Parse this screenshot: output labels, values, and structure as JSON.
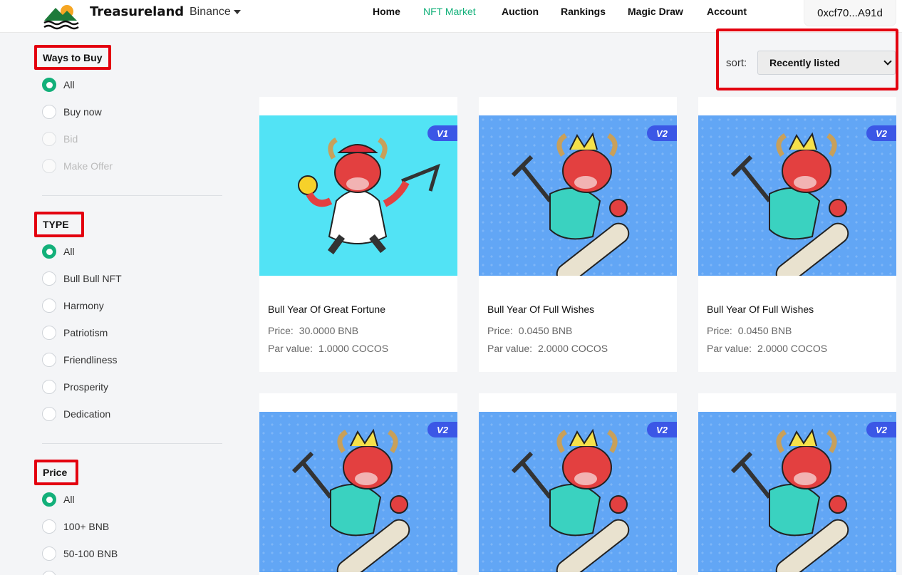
{
  "header": {
    "brand": "Treasureland",
    "network": "Binance",
    "nav": [
      "Home",
      "NFT Market",
      "Auction",
      "Rankings",
      "Magic Draw",
      "Account"
    ],
    "active_nav": "NFT Market",
    "wallet": "0xcf70...A91d"
  },
  "filters": {
    "ways_to_buy": {
      "title": "Ways to Buy",
      "options": [
        "All",
        "Buy now",
        "Bid",
        "Make Offer"
      ],
      "selected": "All",
      "disabled": [
        "Bid",
        "Make Offer"
      ]
    },
    "type": {
      "title": "TYPE",
      "options": [
        "All",
        "Bull Bull NFT",
        "Harmony",
        "Patriotism",
        "Friendliness",
        "Prosperity",
        "Dedication"
      ],
      "selected": "All"
    },
    "price": {
      "title": "Price",
      "options": [
        "All",
        "100+ BNB",
        "50-100 BNB"
      ],
      "selected": "All"
    }
  },
  "sort": {
    "label": "sort:",
    "value": "Recently listed"
  },
  "cards": [
    {
      "version": "V1",
      "title": "Bull Year Of Great Fortune",
      "price_label": "Price:",
      "price": "30.0000 BNB",
      "par_label": "Par value:",
      "par": "1.0000 COCOS"
    },
    {
      "version": "V2",
      "title": "Bull Year Of Full Wishes",
      "price_label": "Price:",
      "price": "0.0450 BNB",
      "par_label": "Par value:",
      "par": "2.0000 COCOS"
    },
    {
      "version": "V2",
      "title": "Bull Year Of Full Wishes",
      "price_label": "Price:",
      "price": "0.0450 BNB",
      "par_label": "Par value:",
      "par": "2.0000 COCOS"
    },
    {
      "version": "V2"
    },
    {
      "version": "V2"
    },
    {
      "version": "V2"
    }
  ],
  "colors": {
    "accent": "#13b07a",
    "highlight": "#e3000f",
    "v1_bg": "#52e3f5",
    "v2_bg": "#62a6f5",
    "badge": "#3b57e6"
  }
}
